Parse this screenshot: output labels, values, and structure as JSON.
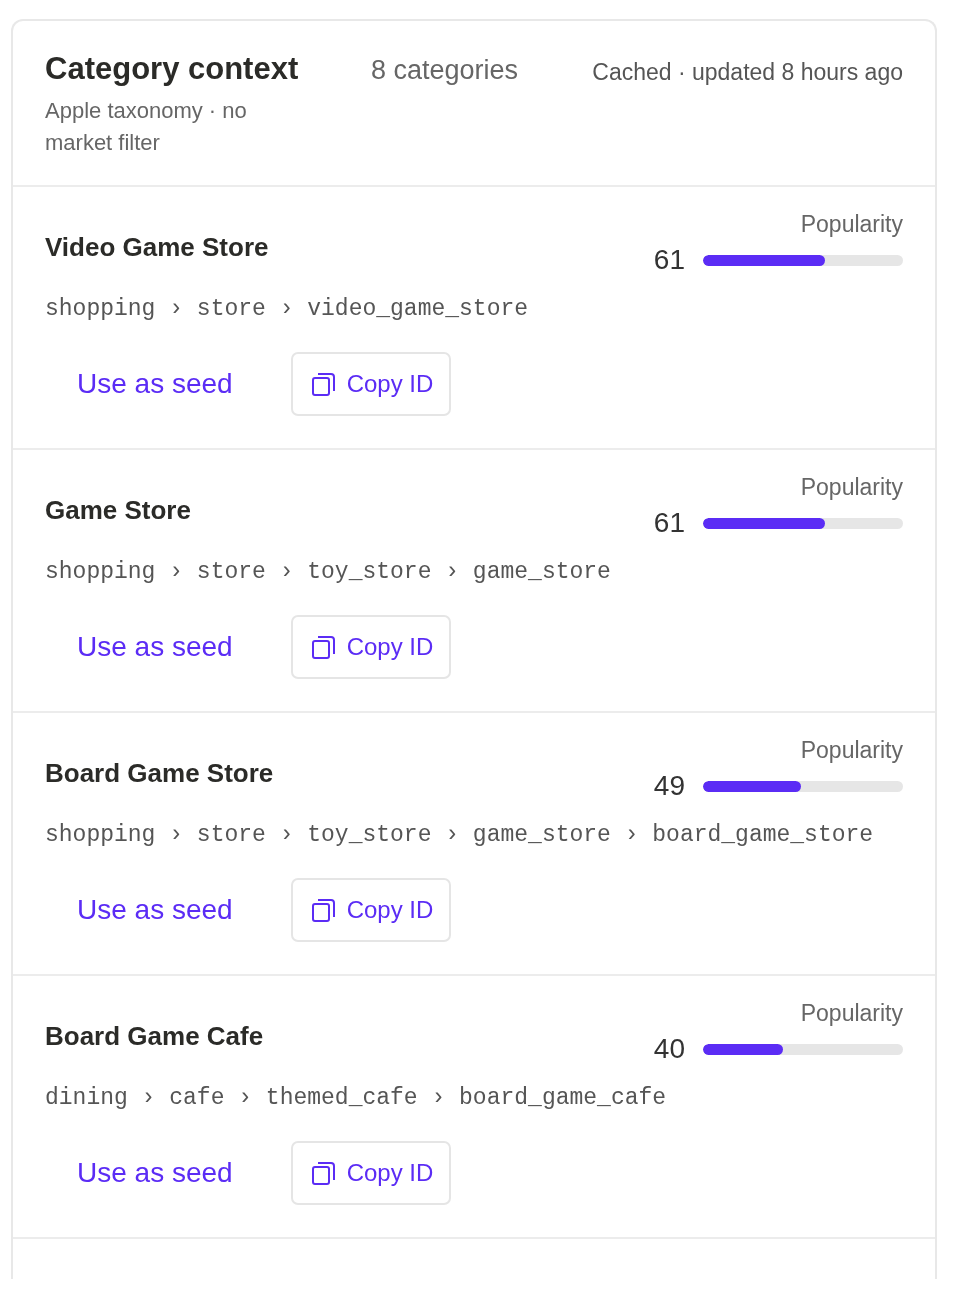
{
  "header": {
    "title": "Category context",
    "subtitle": "Apple taxonomy · no market filter",
    "count": "8 categories",
    "status": "Cached · updated 8 hours ago"
  },
  "categories": [
    {
      "name": "Video Game Store",
      "path": "shopping › store › video_game_store",
      "popularity_label": "Popularity",
      "score": "61",
      "level": 0.61,
      "seed_action": "Use as seed",
      "copy_action": "Copy ID"
    },
    {
      "name": "Game Store",
      "path": "shopping › store › toy_store › game_store",
      "popularity_label": "Popularity",
      "score": "61",
      "level": 0.61,
      "seed_action": "Use as seed",
      "copy_action": "Copy ID"
    },
    {
      "name": "Board Game Store",
      "path": "shopping › store › toy_store › game_store › board_game_store",
      "popularity_label": "Popularity",
      "score": "49",
      "level": 0.49,
      "seed_action": "Use as seed",
      "copy_action": "Copy ID"
    },
    {
      "name": "Board Game Cafe",
      "path": "dining › cafe › themed_cafe › board_game_cafe",
      "popularity_label": "Popularity",
      "score": "40",
      "level": 0.4,
      "seed_action": "Use as seed",
      "copy_action": "Copy ID"
    }
  ]
}
